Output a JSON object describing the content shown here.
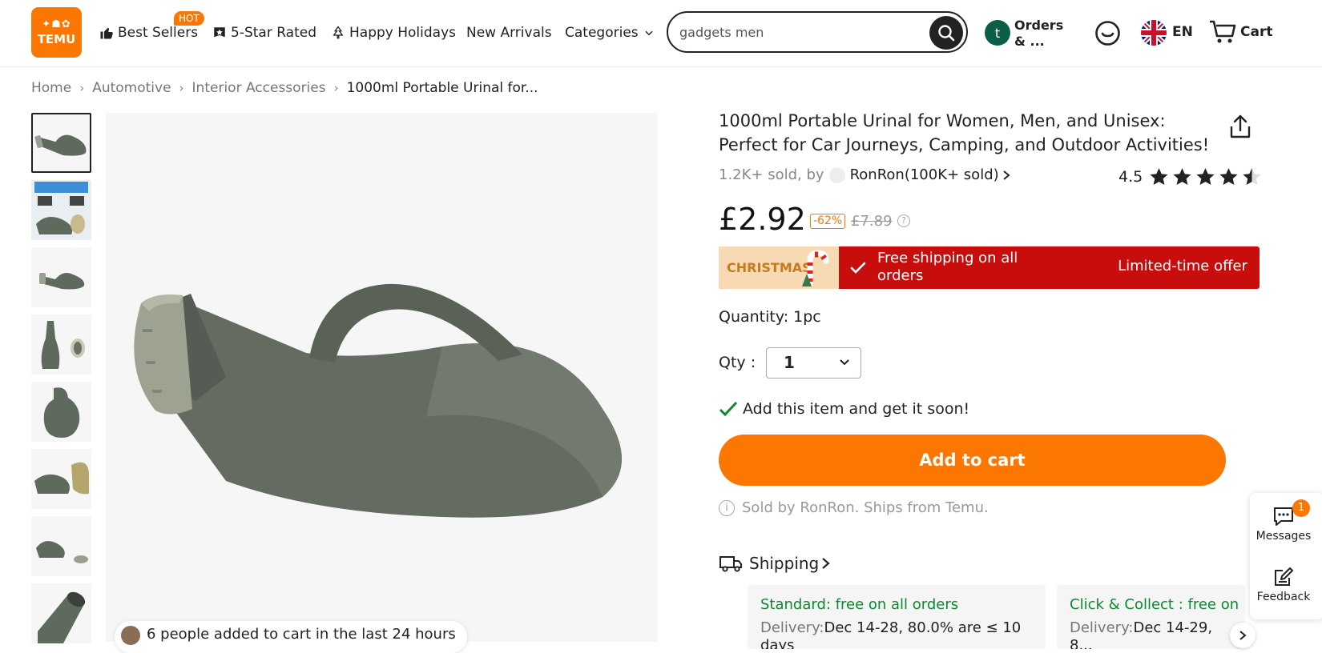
{
  "header": {
    "logo_text": "TEMU",
    "logo_icons": "✦☗✿",
    "nav": [
      {
        "label": "Best Sellers",
        "badge": "HOT"
      },
      {
        "label": "5-Star Rated"
      },
      {
        "label": "Happy Holidays"
      },
      {
        "label": "New Arrivals"
      },
      {
        "label": "Categories"
      }
    ],
    "search": {
      "value": "gadgets men",
      "placeholder": "gadgets men"
    },
    "account_initial": "t",
    "orders_label_1": "Orders",
    "orders_label_2": "& ...",
    "language": "EN",
    "cart_label": "Cart"
  },
  "breadcrumb": [
    "Home",
    "Automotive",
    "Interior Accessories",
    "1000ml Portable Urinal for..."
  ],
  "toast": {
    "text": "6 people added to cart in the last 24 hours"
  },
  "product": {
    "title": "1000ml Portable Urinal for Women, Men, and Unisex: Perfect for Car Journeys, Camping, and Outdoor Activities!",
    "sold_text": "1.2K+ sold, by",
    "seller": "RonRon(100K+ sold)",
    "rating": "4.5",
    "rating_value": 4.5,
    "price": "£2.92",
    "discount": "-62%",
    "old_price": "£7.89",
    "promo": {
      "badge": "CHRISTMAS",
      "text": "Free shipping on all orders",
      "limited": "Limited-time offer"
    },
    "quantity_text": "Quantity: 1pc",
    "qty_label": "Qty :",
    "qty_value": "1",
    "get_soon": "Add this item and get it soon!",
    "add_to_cart": "Add to cart",
    "sold_by": "Sold by RonRon. Ships from Temu."
  },
  "shipping": {
    "heading": "Shipping",
    "options": [
      {
        "title": "Standard: free on all orders",
        "delivery_key": "Delivery:",
        "delivery_value": "Dec 14-28, 80.0% are ≤ 10 days"
      },
      {
        "title": "Click & Collect : free on",
        "delivery_key": "Delivery:",
        "delivery_value": "Dec 14-29, 8..."
      }
    ]
  },
  "side_panel": {
    "messages_label": "Messages",
    "messages_count": "1",
    "feedback_label": "Feedback"
  },
  "colors": {
    "brand": "#fb7701",
    "promo_red": "#c80d0d",
    "green": "#0a8a2e"
  }
}
